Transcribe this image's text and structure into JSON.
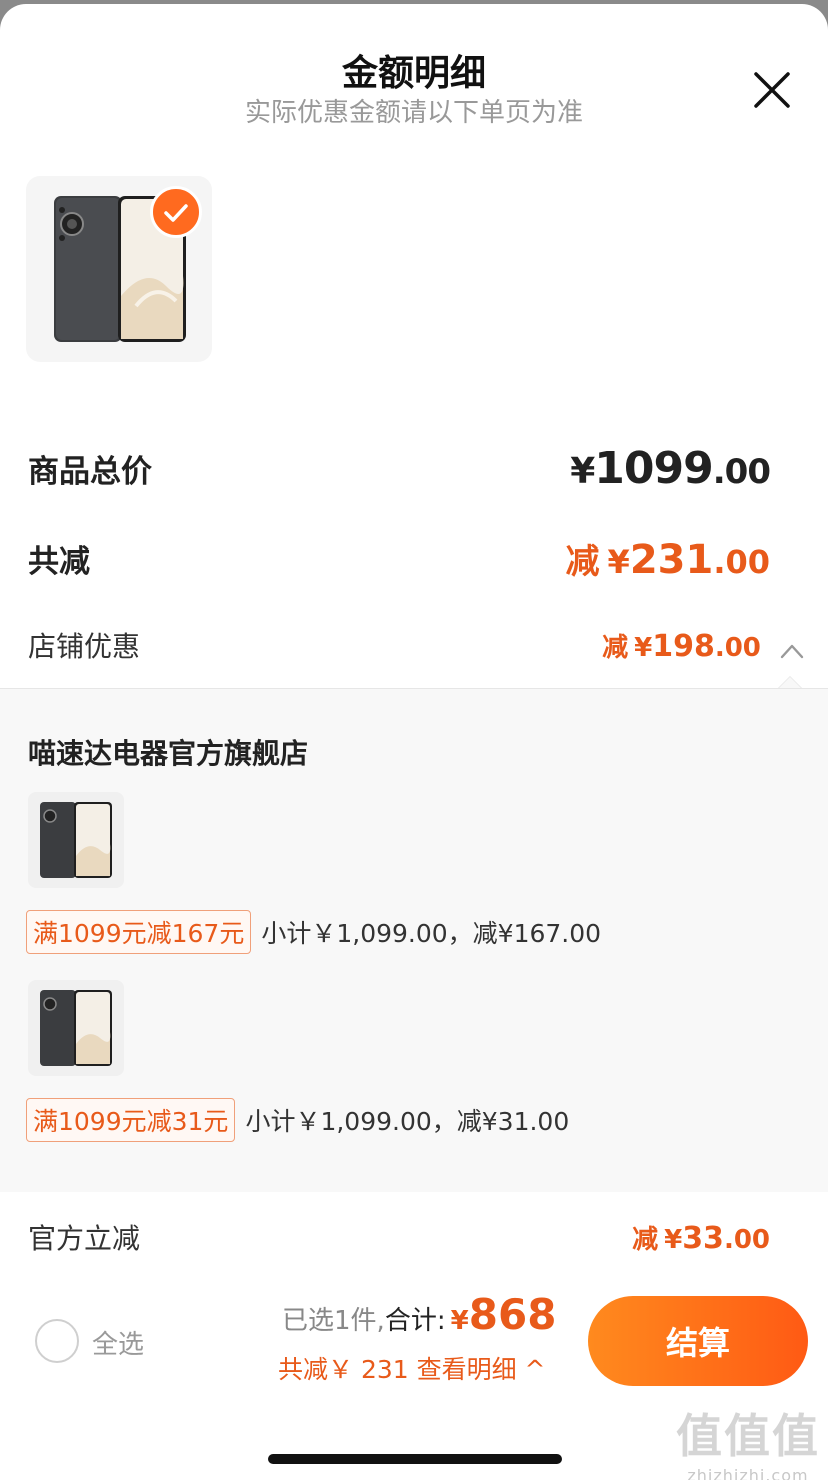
{
  "header": {
    "title": "金额明细",
    "subtitle": "实际优惠金额请以下单页为准",
    "close_icon": "close-icon"
  },
  "product": {
    "thumbnail_icon": "phone-product-image",
    "selected": true
  },
  "totals": {
    "goods_total_label": "商品总价",
    "goods_total_yen": "¥",
    "goods_total_int": "1099",
    "goods_total_dec": ".00",
    "discount_label": "共减",
    "discount_prefix": "减",
    "discount_yen": "¥",
    "discount_int": "231",
    "discount_dec": ".00",
    "store_discount_label": "店铺优惠",
    "store_discount_prefix": "减",
    "store_discount_yen": "¥",
    "store_discount_int": "198",
    "store_discount_dec": ".00",
    "official_discount_label": "官方立减",
    "official_discount_prefix": "减",
    "official_discount_yen": "¥",
    "official_discount_int": "33",
    "official_discount_dec": ".00"
  },
  "store_detail": {
    "store_name": "喵速达电器官方旗舰店",
    "items": [
      {
        "promo_tag": "满1099元减167元",
        "promo_text": "小计￥1,099.00，减¥167.00"
      },
      {
        "promo_tag": "满1099元减31元",
        "promo_text": "小计￥1,099.00，减¥31.00"
      }
    ]
  },
  "footer": {
    "select_all_label": "全选",
    "selected_prefix": "已选1件,",
    "total_label": "合计:",
    "total_yen": "¥",
    "total_amount": "868",
    "discount_summary": "共减￥ 231 查看明细 ^",
    "checkout_label": "结算"
  },
  "watermark": {
    "logo": "值值值",
    "url": "zhizhizhi.com"
  },
  "colors": {
    "accent": "#e85a1a",
    "button_gradient_start": "#ff8a1e",
    "button_gradient_end": "#ff5a14",
    "panel_bg": "#f8f8f8"
  }
}
